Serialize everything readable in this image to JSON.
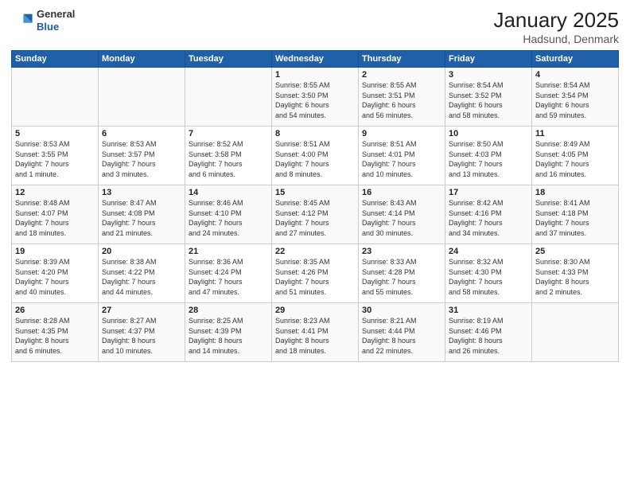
{
  "header": {
    "logo_general": "General",
    "logo_blue": "Blue",
    "title": "January 2025",
    "location": "Hadsund, Denmark"
  },
  "days_of_week": [
    "Sunday",
    "Monday",
    "Tuesday",
    "Wednesday",
    "Thursday",
    "Friday",
    "Saturday"
  ],
  "weeks": [
    [
      {
        "day": "",
        "detail": ""
      },
      {
        "day": "",
        "detail": ""
      },
      {
        "day": "",
        "detail": ""
      },
      {
        "day": "1",
        "detail": "Sunrise: 8:55 AM\nSunset: 3:50 PM\nDaylight: 6 hours\nand 54 minutes."
      },
      {
        "day": "2",
        "detail": "Sunrise: 8:55 AM\nSunset: 3:51 PM\nDaylight: 6 hours\nand 56 minutes."
      },
      {
        "day": "3",
        "detail": "Sunrise: 8:54 AM\nSunset: 3:52 PM\nDaylight: 6 hours\nand 58 minutes."
      },
      {
        "day": "4",
        "detail": "Sunrise: 8:54 AM\nSunset: 3:54 PM\nDaylight: 6 hours\nand 59 minutes."
      }
    ],
    [
      {
        "day": "5",
        "detail": "Sunrise: 8:53 AM\nSunset: 3:55 PM\nDaylight: 7 hours\nand 1 minute."
      },
      {
        "day": "6",
        "detail": "Sunrise: 8:53 AM\nSunset: 3:57 PM\nDaylight: 7 hours\nand 3 minutes."
      },
      {
        "day": "7",
        "detail": "Sunrise: 8:52 AM\nSunset: 3:58 PM\nDaylight: 7 hours\nand 6 minutes."
      },
      {
        "day": "8",
        "detail": "Sunrise: 8:51 AM\nSunset: 4:00 PM\nDaylight: 7 hours\nand 8 minutes."
      },
      {
        "day": "9",
        "detail": "Sunrise: 8:51 AM\nSunset: 4:01 PM\nDaylight: 7 hours\nand 10 minutes."
      },
      {
        "day": "10",
        "detail": "Sunrise: 8:50 AM\nSunset: 4:03 PM\nDaylight: 7 hours\nand 13 minutes."
      },
      {
        "day": "11",
        "detail": "Sunrise: 8:49 AM\nSunset: 4:05 PM\nDaylight: 7 hours\nand 16 minutes."
      }
    ],
    [
      {
        "day": "12",
        "detail": "Sunrise: 8:48 AM\nSunset: 4:07 PM\nDaylight: 7 hours\nand 18 minutes."
      },
      {
        "day": "13",
        "detail": "Sunrise: 8:47 AM\nSunset: 4:08 PM\nDaylight: 7 hours\nand 21 minutes."
      },
      {
        "day": "14",
        "detail": "Sunrise: 8:46 AM\nSunset: 4:10 PM\nDaylight: 7 hours\nand 24 minutes."
      },
      {
        "day": "15",
        "detail": "Sunrise: 8:45 AM\nSunset: 4:12 PM\nDaylight: 7 hours\nand 27 minutes."
      },
      {
        "day": "16",
        "detail": "Sunrise: 8:43 AM\nSunset: 4:14 PM\nDaylight: 7 hours\nand 30 minutes."
      },
      {
        "day": "17",
        "detail": "Sunrise: 8:42 AM\nSunset: 4:16 PM\nDaylight: 7 hours\nand 34 minutes."
      },
      {
        "day": "18",
        "detail": "Sunrise: 8:41 AM\nSunset: 4:18 PM\nDaylight: 7 hours\nand 37 minutes."
      }
    ],
    [
      {
        "day": "19",
        "detail": "Sunrise: 8:39 AM\nSunset: 4:20 PM\nDaylight: 7 hours\nand 40 minutes."
      },
      {
        "day": "20",
        "detail": "Sunrise: 8:38 AM\nSunset: 4:22 PM\nDaylight: 7 hours\nand 44 minutes."
      },
      {
        "day": "21",
        "detail": "Sunrise: 8:36 AM\nSunset: 4:24 PM\nDaylight: 7 hours\nand 47 minutes."
      },
      {
        "day": "22",
        "detail": "Sunrise: 8:35 AM\nSunset: 4:26 PM\nDaylight: 7 hours\nand 51 minutes."
      },
      {
        "day": "23",
        "detail": "Sunrise: 8:33 AM\nSunset: 4:28 PM\nDaylight: 7 hours\nand 55 minutes."
      },
      {
        "day": "24",
        "detail": "Sunrise: 8:32 AM\nSunset: 4:30 PM\nDaylight: 7 hours\nand 58 minutes."
      },
      {
        "day": "25",
        "detail": "Sunrise: 8:30 AM\nSunset: 4:33 PM\nDaylight: 8 hours\nand 2 minutes."
      }
    ],
    [
      {
        "day": "26",
        "detail": "Sunrise: 8:28 AM\nSunset: 4:35 PM\nDaylight: 8 hours\nand 6 minutes."
      },
      {
        "day": "27",
        "detail": "Sunrise: 8:27 AM\nSunset: 4:37 PM\nDaylight: 8 hours\nand 10 minutes."
      },
      {
        "day": "28",
        "detail": "Sunrise: 8:25 AM\nSunset: 4:39 PM\nDaylight: 8 hours\nand 14 minutes."
      },
      {
        "day": "29",
        "detail": "Sunrise: 8:23 AM\nSunset: 4:41 PM\nDaylight: 8 hours\nand 18 minutes."
      },
      {
        "day": "30",
        "detail": "Sunrise: 8:21 AM\nSunset: 4:44 PM\nDaylight: 8 hours\nand 22 minutes."
      },
      {
        "day": "31",
        "detail": "Sunrise: 8:19 AM\nSunset: 4:46 PM\nDaylight: 8 hours\nand 26 minutes."
      },
      {
        "day": "",
        "detail": ""
      }
    ]
  ]
}
